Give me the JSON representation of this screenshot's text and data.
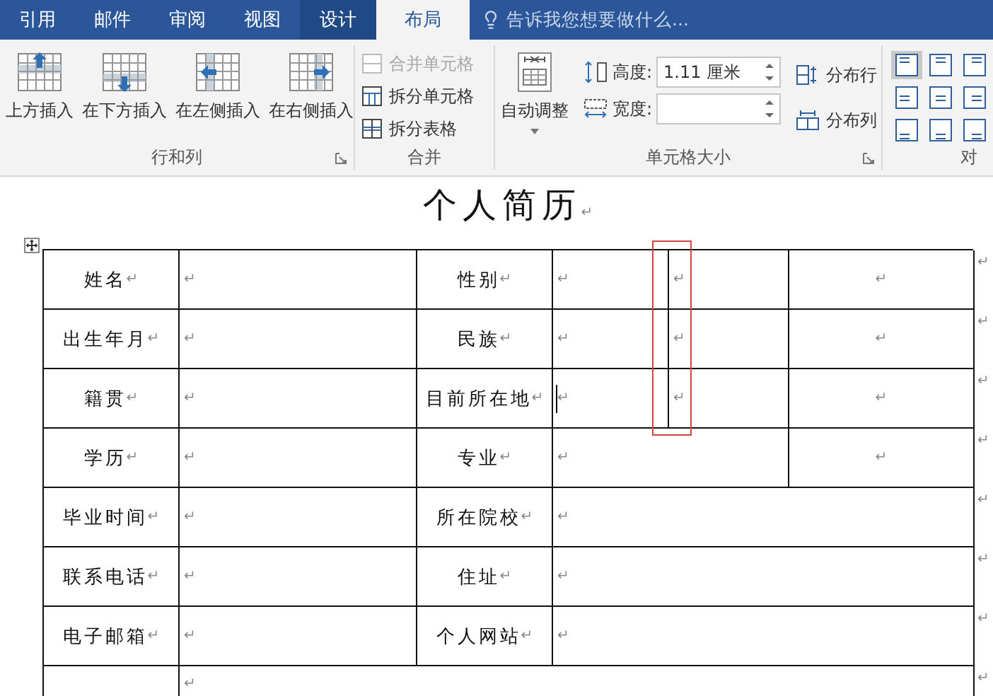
{
  "ribbon_tabs": [
    {
      "label": "引用",
      "selected": false,
      "contextual": false
    },
    {
      "label": "邮件",
      "selected": false,
      "contextual": false
    },
    {
      "label": "审阅",
      "selected": false,
      "contextual": false
    },
    {
      "label": "视图",
      "selected": false,
      "contextual": false
    },
    {
      "label": "设计",
      "selected": false,
      "contextual": true
    },
    {
      "label": "布局",
      "selected": true,
      "contextual": true
    }
  ],
  "tell_me": {
    "placeholder": "告诉我您想要做什么..."
  },
  "rows_columns": {
    "label": "行和列",
    "launcher": true,
    "buttons": [
      "上方插入",
      "在下方插入",
      "在左侧插入",
      "在右侧插入"
    ]
  },
  "merge": {
    "label": "合并",
    "buttons": [
      {
        "label": "合并单元格",
        "disabled": true
      },
      {
        "label": "拆分单元格",
        "disabled": false
      },
      {
        "label": "拆分表格",
        "disabled": false
      }
    ]
  },
  "cell_size": {
    "label": "单元格大小",
    "launcher": true,
    "autofit": "自动调整",
    "height": {
      "label": "高度:",
      "value": "1.11 厘米"
    },
    "width": {
      "label": "宽度:"
    },
    "distribute": [
      "分布行",
      "分布列"
    ]
  },
  "alignment": {
    "label": "对",
    "options": [
      {
        "selected": true
      },
      {
        "selected": false
      },
      {
        "selected": false
      },
      {
        "selected": false
      },
      {
        "selected": false
      },
      {
        "selected": false
      },
      {
        "selected": false
      },
      {
        "selected": false
      },
      {
        "selected": false
      }
    ]
  },
  "document": {
    "title": "个人简历",
    "title_mark": "↵",
    "annotation": {
      "kind": "red-box"
    },
    "rows": [
      {
        "end_mark": "↵",
        "cells": [
          {
            "kind": "label",
            "text": "姓名",
            "mark": "↵"
          },
          {
            "kind": "blank",
            "mark": "↵"
          },
          {
            "kind": "label",
            "text": "性别",
            "mark": "↵"
          },
          {
            "kind": "blank",
            "mark": "↵"
          },
          {
            "kind": "blank",
            "mark": "↵"
          },
          {
            "kind": "center-blank",
            "mark": "↵"
          }
        ]
      },
      {
        "end_mark": "↵",
        "cells": [
          {
            "kind": "label",
            "text": "出生年月",
            "mark": "↵"
          },
          {
            "kind": "blank",
            "mark": "↵"
          },
          {
            "kind": "label",
            "text": "民族",
            "mark": "↵"
          },
          {
            "kind": "blank",
            "mark": "↵"
          },
          {
            "kind": "blank",
            "mark": "↵"
          },
          {
            "kind": "center-blank",
            "mark": "↵"
          }
        ]
      },
      {
        "end_mark": "↵",
        "cells": [
          {
            "kind": "label",
            "text": "籍贯",
            "mark": "↵"
          },
          {
            "kind": "blank",
            "mark": "↵"
          },
          {
            "kind": "label",
            "text": "目前所在地",
            "mark": "↵"
          },
          {
            "kind": "blank",
            "mark": "↵",
            "cursor": true
          },
          {
            "kind": "blank",
            "mark": "↵"
          },
          {
            "kind": "center-blank",
            "mark": "↵"
          }
        ]
      },
      {
        "end_mark": "↵",
        "cells": [
          {
            "kind": "label",
            "text": "学历",
            "mark": "↵"
          },
          {
            "kind": "blank",
            "mark": "↵"
          },
          {
            "kind": "label",
            "text": "专业",
            "mark": "↵"
          },
          {
            "kind": "blank",
            "mark": "↵"
          },
          {
            "kind": "merged"
          },
          {
            "kind": "center-blank",
            "mark": "↵"
          }
        ]
      },
      {
        "end_mark": "↵",
        "cells": [
          {
            "kind": "label",
            "text": "毕业时间",
            "mark": "↵"
          },
          {
            "kind": "blank",
            "mark": "↵"
          },
          {
            "kind": "label",
            "text": "所在院校",
            "mark": "↵"
          },
          {
            "kind": "blank",
            "mark": "↵"
          },
          {
            "kind": "merged"
          },
          {
            "kind": "merged"
          }
        ]
      },
      {
        "end_mark": "↵",
        "cells": [
          {
            "kind": "label",
            "text": "联系电话",
            "mark": "↵"
          },
          {
            "kind": "blank",
            "mark": "↵"
          },
          {
            "kind": "label",
            "text": "住址",
            "mark": "↵"
          },
          {
            "kind": "blank",
            "mark": "↵"
          },
          {
            "kind": "merged"
          },
          {
            "kind": "merged"
          }
        ]
      },
      {
        "end_mark": "↵",
        "cells": [
          {
            "kind": "label",
            "text": "电子邮箱",
            "mark": "↵"
          },
          {
            "kind": "blank",
            "mark": "↵"
          },
          {
            "kind": "label",
            "text": "个人网站",
            "mark": "↵"
          },
          {
            "kind": "blank",
            "mark": "↵"
          },
          {
            "kind": "merged"
          },
          {
            "kind": "merged"
          }
        ]
      },
      {
        "end_mark": "↵",
        "cells": [
          {
            "kind": "blank"
          },
          {
            "kind": "blank",
            "mark": "↵"
          },
          {
            "kind": "merged"
          },
          {
            "kind": "merged"
          },
          {
            "kind": "merged"
          },
          {
            "kind": "merged"
          }
        ]
      }
    ]
  }
}
